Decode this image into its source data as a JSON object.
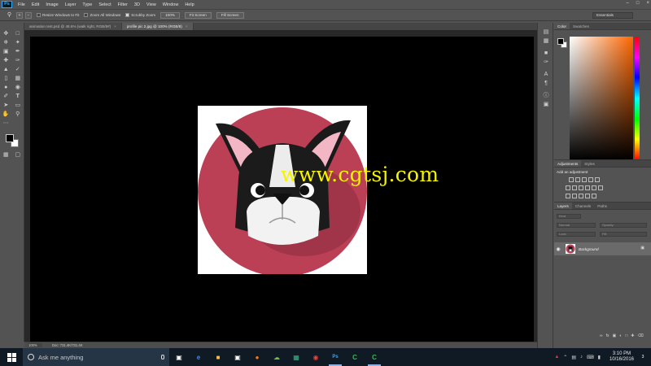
{
  "app": {
    "logo": "Ps",
    "menu": [
      "File",
      "Edit",
      "Image",
      "Layer",
      "Type",
      "Select",
      "Filter",
      "3D",
      "View",
      "Window",
      "Help"
    ],
    "window_controls": [
      "–",
      "□",
      "×"
    ]
  },
  "options_bar": {
    "resize_windows_label": "Resize Windows to Fit",
    "zoom_all_windows_label": "Zoom All Windows",
    "scrubby_zoom_label": "Scrubby Zoom",
    "zoom_percent": "100%",
    "fit_screen_label": "Fit Screen",
    "fill_screen_label": "Fill Screen",
    "workspace": "Essentials"
  },
  "documents": {
    "tabs": [
      {
        "label": "animation test.psd @ 48.6% (walk right, RGB/8#)",
        "active": false
      },
      {
        "label": "profile pic 2.jpg @ 100% (RGB/8)",
        "active": true
      }
    ]
  },
  "canvas": {
    "watermark": "www.cgtsj.com",
    "background_color": "#000000",
    "artwork": {
      "circle_color": "#bb3f55",
      "shadow_color": "#8e2e41",
      "ear_inner_color": "#f3b6c4"
    }
  },
  "status": {
    "zoom": "100%",
    "doc_size": "Doc: 731.4K/731.4K"
  },
  "panels": {
    "color_tabs": [
      "Color",
      "Swatches"
    ],
    "adjust_tabs": [
      "Adjustments",
      "Styles"
    ],
    "adjust_title": "Add an adjustment",
    "layers_tabs": [
      "Layers",
      "Channels",
      "Paths"
    ],
    "kind_label": "Kind",
    "blend_mode": "Normal",
    "opacity_label": "Opacity:",
    "lock_label": "Lock:",
    "fill_label": "Fill:",
    "layer": {
      "name": "Background"
    }
  },
  "taskbar": {
    "search_placeholder": "Ask me anything",
    "time": "3:10 PM",
    "date": "10/16/2016",
    "notification_count": "3"
  }
}
